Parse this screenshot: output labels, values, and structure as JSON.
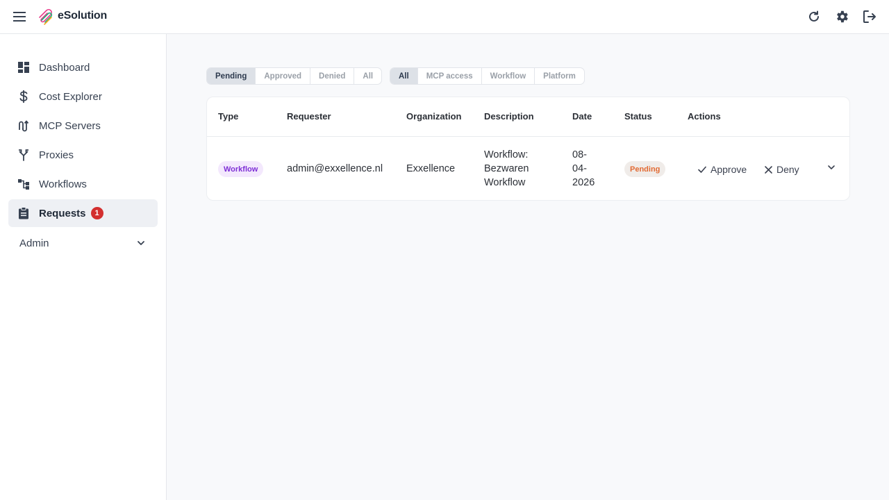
{
  "app": {
    "brand": "eSolution"
  },
  "header": {
    "icons": [
      "menu-icon",
      "refresh-icon",
      "gear-icon",
      "logout-icon"
    ]
  },
  "sidebar": {
    "items": [
      {
        "label": "Dashboard",
        "icon": "dashboard-icon"
      },
      {
        "label": "Cost Explorer",
        "icon": "dollar-icon"
      },
      {
        "label": "MCP Servers",
        "icon": "mcp-icon"
      },
      {
        "label": "Proxies",
        "icon": "fork-icon"
      },
      {
        "label": "Workflows",
        "icon": "workflow-icon"
      },
      {
        "label": "Requests",
        "icon": "clipboard-icon",
        "badge": "1",
        "active": true
      }
    ],
    "admin_label": "Admin"
  },
  "filters": {
    "status": [
      "Pending",
      "Approved",
      "Denied",
      "All"
    ],
    "status_selected": "Pending",
    "type": [
      "All",
      "MCP access",
      "Workflow",
      "Platform"
    ],
    "type_selected": "All"
  },
  "table": {
    "headers": [
      "Type",
      "Requester",
      "Organization",
      "Description",
      "Date",
      "Status",
      "Actions"
    ],
    "rows": [
      {
        "type": "Workflow",
        "requester": "admin@exxellence.nl",
        "organization": "Exxellence",
        "description": [
          "Workflow:",
          "Bezwaren",
          "Workflow"
        ],
        "date": [
          "08-",
          "04-",
          "2026"
        ],
        "status": "Pending",
        "approve_label": "Approve",
        "deny_label": "Deny"
      }
    ]
  },
  "colors": {
    "accent_badge": "#d32f2f",
    "type_pill_text": "#7e2fd6",
    "status_pending_text": "#e26a33"
  }
}
